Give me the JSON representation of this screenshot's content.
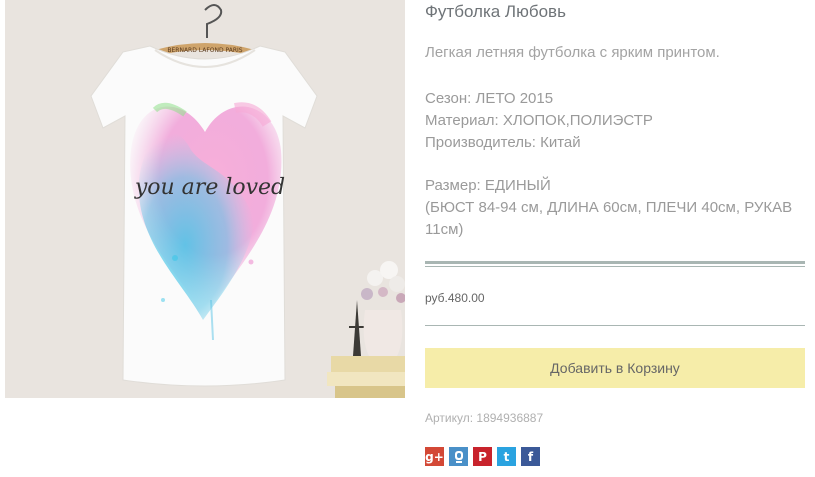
{
  "product": {
    "title": "Футболка Любовь",
    "description": "Легкая летняя футболка с ярким принтом.",
    "specs": [
      "Сезон: ЛЕТО 2015",
      "Материал: ХЛОПОК,ПОЛИЭСТР",
      "Производитель: Китай"
    ],
    "size_line1": "Размер: ЕДИНЫЙ",
    "size_line2": "(БЮСТ 84-94 см, ДЛИНА 60см, ПЛЕЧИ 40см, РУКАВ 11см)",
    "print_text": "you are loved",
    "hanger_label": "BERNARD LAFOND PARIS",
    "price": "руб.480.00",
    "add_to_cart_label": "Добавить в Корзину",
    "sku": "Артикул: 1894936887"
  },
  "share": {
    "buttons": [
      {
        "icon": "google-plus-icon",
        "glyph": "g+",
        "color": "#d34836"
      },
      {
        "icon": "odnoklassniki-icon",
        "glyph": "ok",
        "color": "#4a90c8"
      },
      {
        "icon": "pinterest-icon",
        "glyph": "P",
        "color": "#c8232c"
      },
      {
        "icon": "twitter-icon",
        "glyph": "t",
        "color": "#2aa3e0"
      },
      {
        "icon": "facebook-icon",
        "glyph": "f",
        "color": "#3b5998"
      }
    ]
  },
  "colors": {
    "accent_button": "#f6eda9",
    "rule": "#a9b6b3"
  }
}
